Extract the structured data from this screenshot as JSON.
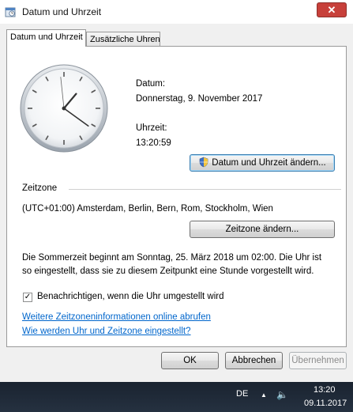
{
  "window": {
    "title": "Datum und Uhrzeit",
    "close_symbol": "✕"
  },
  "tabs": [
    {
      "label": "Datum und Uhrzeit",
      "active": true
    },
    {
      "label": "Zusätzliche Uhren",
      "active": false
    }
  ],
  "clock": {
    "time": "13:20:59"
  },
  "date_section": {
    "date_label": "Datum:",
    "date_value": "Donnerstag, 9. November 2017",
    "time_label": "Uhrzeit:",
    "time_value": "13:20:59",
    "change_button": "Datum und Uhrzeit ändern..."
  },
  "timezone_section": {
    "heading": "Zeitzone",
    "value": "(UTC+01:00) Amsterdam, Berlin, Bern, Rom, Stockholm, Wien",
    "change_button": "Zeitzone ändern..."
  },
  "dst_info": {
    "line1": "Die Sommerzeit beginnt am Sonntag, 25. März 2018 um 02:00. Die Uhr ist",
    "line2": "so eingestellt, dass sie zu diesem Zeitpunkt eine Stunde vorgestellt wird."
  },
  "notify_checkbox": {
    "label": "Benachrichtigen, wenn die Uhr umgestellt wird",
    "checked": true,
    "mark": "✓"
  },
  "links": {
    "more_info": "Weitere Zeitzoneninformationen online abrufen",
    "how_set": "Wie werden Uhr und Zeitzone eingestellt?"
  },
  "footer_buttons": {
    "ok": "OK",
    "cancel": "Abbrechen",
    "apply": "Übernehmen"
  },
  "taskbar": {
    "language": "DE",
    "tray_arrow": "▲",
    "volume_icon": "🔈",
    "time": "13:20",
    "date": "09.11.2017"
  },
  "colors": {
    "link": "#0066cc",
    "close_button": "#c7403a"
  }
}
